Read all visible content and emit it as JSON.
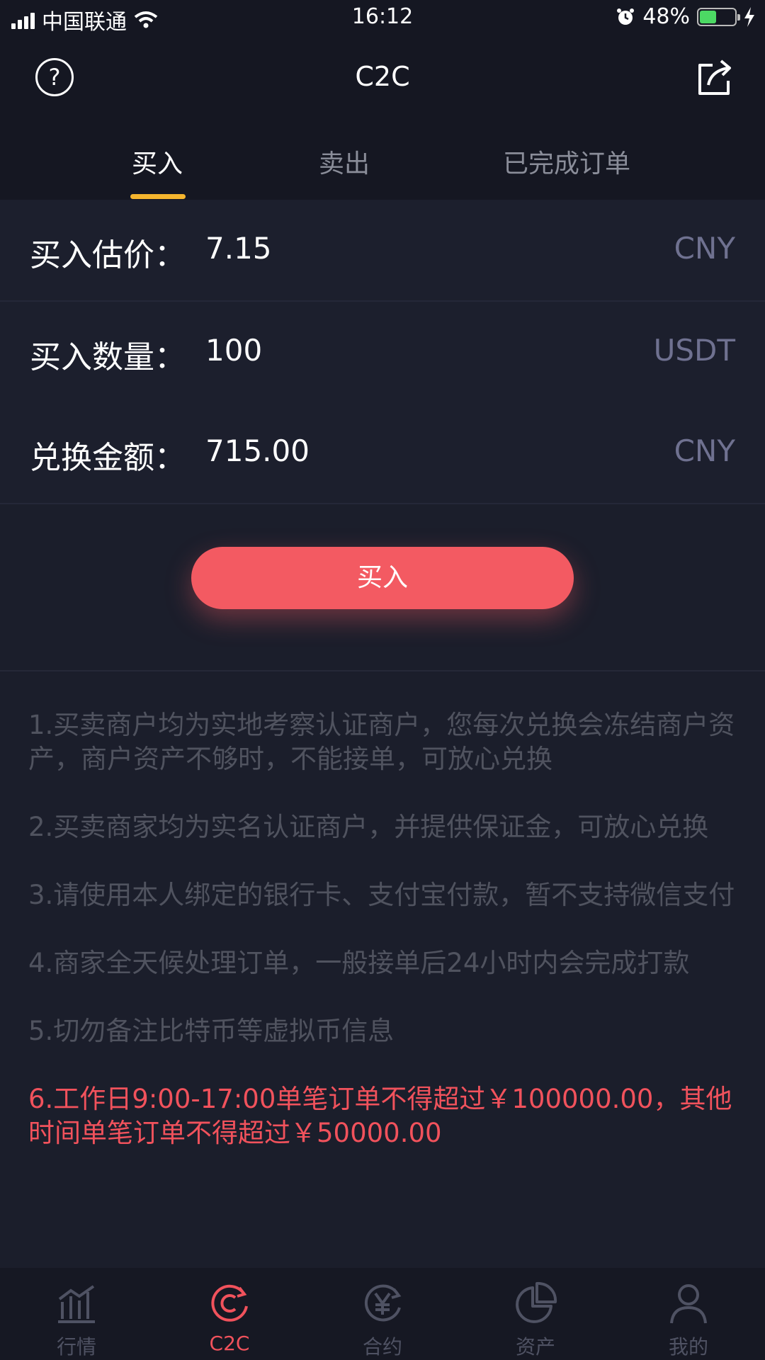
{
  "status_bar": {
    "carrier": "中国联通",
    "time": "16:12",
    "battery": "48%",
    "battery_level": 0.48
  },
  "nav": {
    "title": "C2C",
    "help_glyph": "?"
  },
  "tabs": [
    {
      "label": "买入",
      "active": true
    },
    {
      "label": "卖出",
      "active": false
    },
    {
      "label": "已完成订单",
      "active": false
    }
  ],
  "form": {
    "price": {
      "label": "买入估价：",
      "value": "7.15",
      "unit": "CNY"
    },
    "quantity": {
      "label": "买入数量：",
      "value": "100",
      "unit": "USDT"
    },
    "amount": {
      "label": "兑换金额：",
      "value": "715.00",
      "unit": "CNY"
    }
  },
  "buy_button": {
    "label": "买入"
  },
  "notes": [
    "1.买卖商户均为实地考察认证商户，您每次兑换会冻结商户资产，商户资产不够时，不能接单，可放心兑换",
    "2.买卖商家均为实名认证商户，并提供保证金，可放心兑换",
    "3.请使用本人绑定的银行卡、支付宝付款，暂不支持微信支付",
    "4.商家全天候处理订单，一般接单后24小时内会完成打款",
    "5.切勿备注比特币等虚拟币信息",
    "6.工作日9:00-17:00单笔订单不得超过￥100000.00，其他时间单笔订单不得超过￥50000.00"
  ],
  "tab_bar": [
    {
      "label": "行情",
      "icon": "market-chart-icon",
      "active": false
    },
    {
      "label": "C2C",
      "icon": "c2c-icon",
      "active": true
    },
    {
      "label": "合约",
      "icon": "yuan-contract-icon",
      "active": false
    },
    {
      "label": "资产",
      "icon": "pie-chart-icon",
      "active": false
    },
    {
      "label": "我的",
      "icon": "user-icon",
      "active": false
    }
  ],
  "colors": {
    "background": "#1b1e2b",
    "accent_red": "#f35a62",
    "tab_indicator": "#f5b52e",
    "unit_text": "#6f7190",
    "note_text": "#50535f"
  }
}
